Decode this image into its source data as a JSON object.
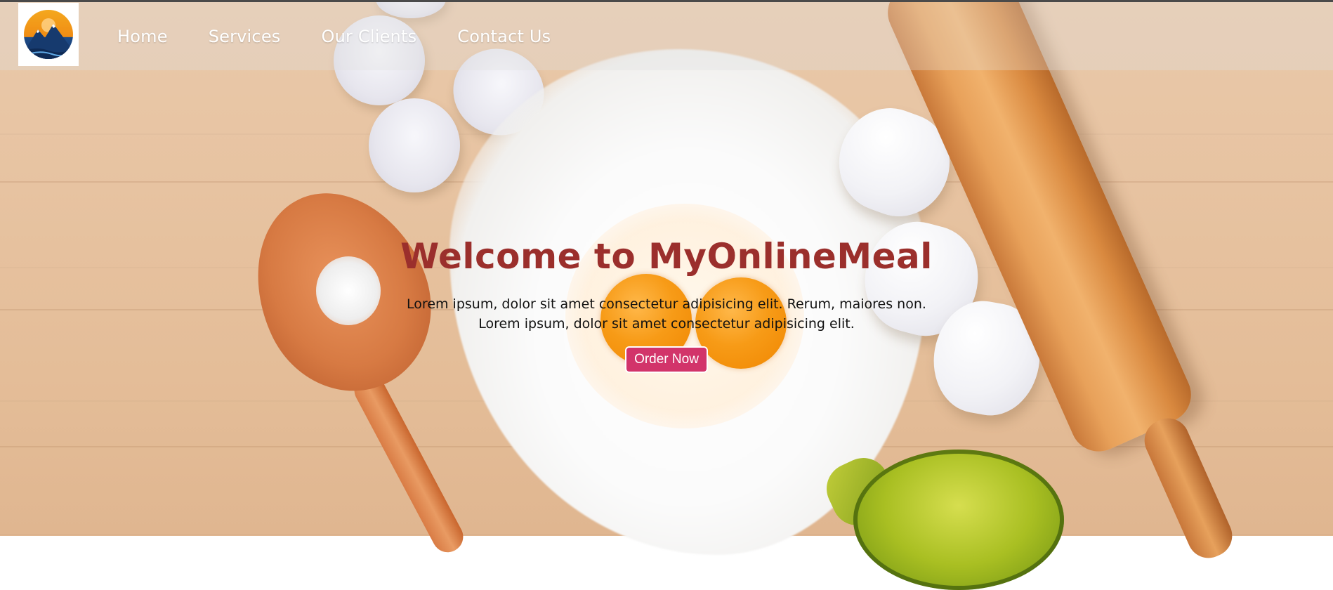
{
  "nav": {
    "logo_alt": "MyOnlineMeal logo",
    "links": [
      {
        "label": "Home"
      },
      {
        "label": "Services"
      },
      {
        "label": "Our Clients"
      },
      {
        "label": "Contact Us"
      }
    ]
  },
  "hero": {
    "title": "Welcome to MyOnlineMeal",
    "text_line1": "Lorem ipsum, dolor sit amet consectetur adipisicing elit. Rerum, maiores non.",
    "text_line2": "Lorem ipsum, dolor sit amet consectetur adipisicing elit.",
    "button_label": "Order Now"
  },
  "colors": {
    "title": "#9b2f2c",
    "button": "#d2346a",
    "nav_text": "#ffffff",
    "background": "#e7c3a1"
  },
  "icons": {
    "logo": "mountain-sunset-logo-icon"
  }
}
